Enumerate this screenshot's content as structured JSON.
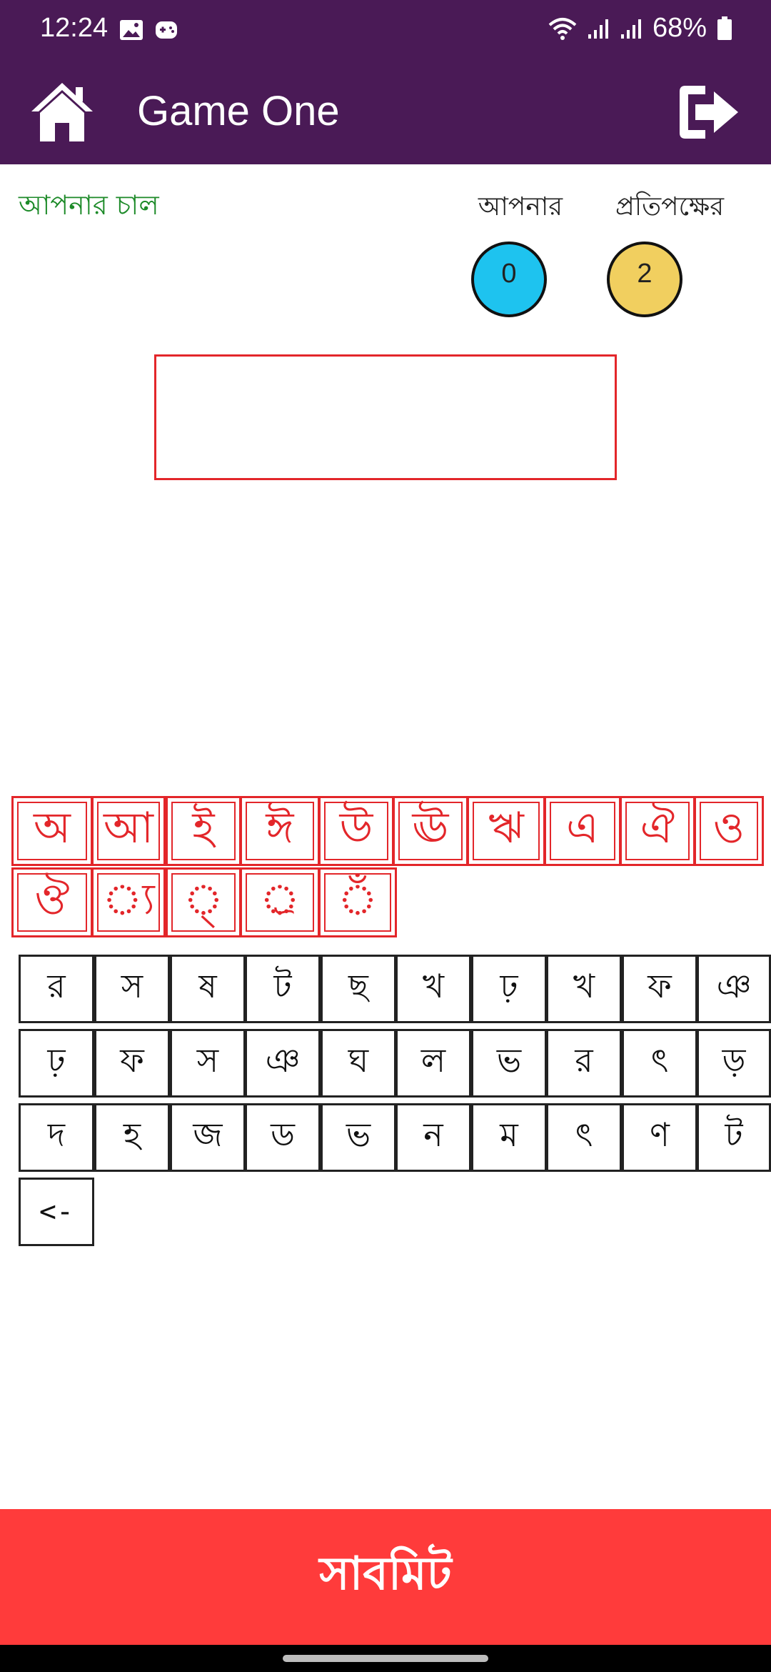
{
  "status_bar": {
    "time": "12:24",
    "battery": "68%"
  },
  "app_bar": {
    "title": "Game One"
  },
  "turn_label": "আপনার চাল",
  "scores": {
    "you_label": "আপনার",
    "you_value": "0",
    "opponent_label": "প্রতিপক্ষের",
    "opponent_value": "2",
    "you_color": "#1ec3ef",
    "opponent_color": "#f1cf5f"
  },
  "vowels_row1": [
    "অ",
    "আ",
    "ই",
    "ঈ",
    "উ",
    "ঊ",
    "ঋ",
    "এ",
    "ঐ",
    "ও"
  ],
  "vowels_row2": [
    "ঔ",
    "্য",
    "্",
    "্র",
    "ঁ"
  ],
  "consonants_row1": [
    "র",
    "স",
    "ষ",
    "ট",
    "ছ",
    "খ",
    "ঢ়",
    "খ",
    "ফ",
    "ঞ"
  ],
  "consonants_row2": [
    "ঢ়",
    "ফ",
    "স",
    "ঞ",
    "ঘ",
    "ল",
    "ভ",
    "র",
    "ৎ",
    "ড়"
  ],
  "consonants_row3": [
    "দ",
    "হ",
    "জ",
    "ড",
    "ভ",
    "ন",
    "ম",
    "ৎ",
    "ণ",
    "ট"
  ],
  "backspace_label": "<-",
  "submit_label": "সাবমিট",
  "colors": {
    "primary": "#4a1a56",
    "accent_red": "#e3262a",
    "submit": "#ff3b3b",
    "turn_green": "#1c8a28"
  }
}
